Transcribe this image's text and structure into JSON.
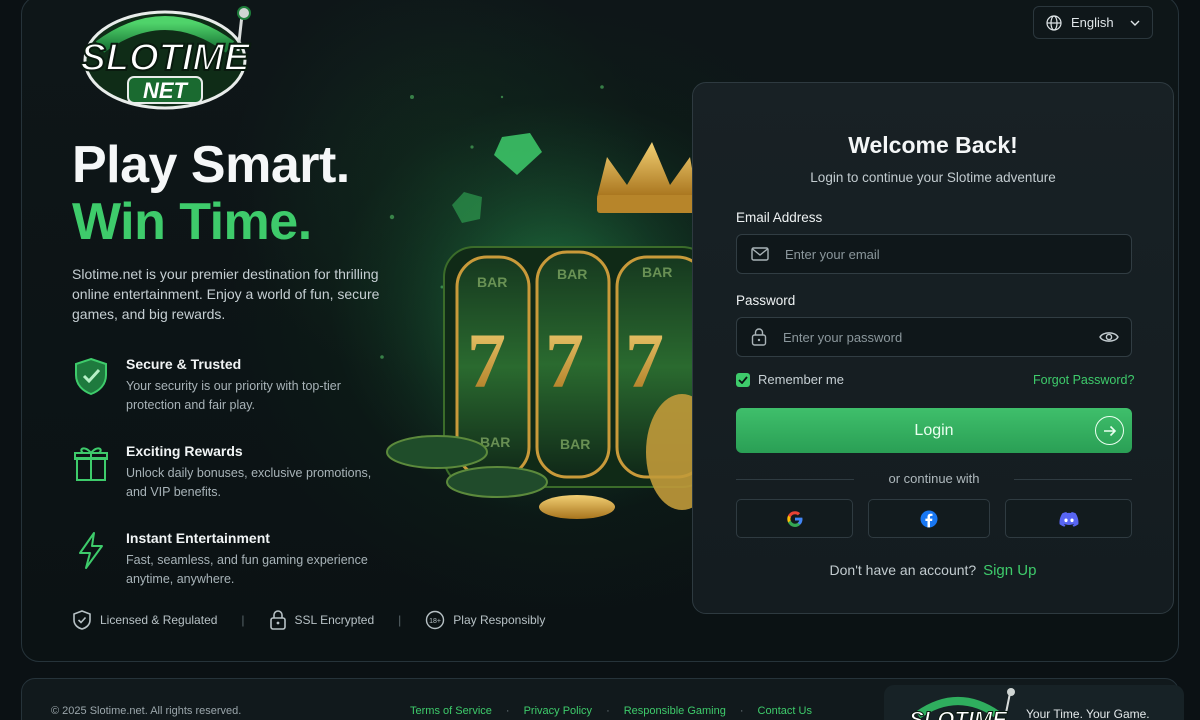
{
  "brand": {
    "logo_line1": "SLOTIME",
    "logo_line2": "NET"
  },
  "language": {
    "selected": "English",
    "icon": "globe-icon"
  },
  "hero": {
    "headline_line1": "Play Smart.",
    "headline_line2": "Win Time.",
    "intro": "Slotime.net is your premier destination for thrilling online entertainment. Enjoy a world of fun, secure games, and big rewards.",
    "features": [
      {
        "title": "Secure & Trusted",
        "desc": "Your security is our priority with top-tier protection and fair play.",
        "icon": "shield-check-icon"
      },
      {
        "title": "Exciting Rewards",
        "desc": "Unlock daily bonuses, exclusive promotions, and VIP benefits.",
        "icon": "gift-icon"
      },
      {
        "title": "Instant Entertainment",
        "desc": "Fast, seamless, and fun gaming experience anytime, anywhere.",
        "icon": "lightning-icon"
      }
    ],
    "badges": [
      {
        "label": "Licensed & Regulated",
        "icon": "shield-icon"
      },
      {
        "label": "SSL Encrypted",
        "icon": "lock-icon"
      },
      {
        "label": "Play Responsibly",
        "icon": "age-18-icon",
        "icon_text": "18+"
      }
    ]
  },
  "login": {
    "title": "Welcome Back!",
    "subtitle": "Login to continue your Slotime adventure",
    "email_label": "Email Address",
    "email_placeholder": "Enter your email",
    "password_label": "Password",
    "password_placeholder": "Enter your password",
    "remember_label": "Remember me",
    "remember_checked": true,
    "forgot_label": "Forgot Password?",
    "submit_label": "Login",
    "divider_text": "or continue with",
    "social": [
      "google-icon",
      "facebook-icon",
      "discord-icon"
    ],
    "no_account_text": "Don't have an account?",
    "signup_label": "Sign Up"
  },
  "footer": {
    "copyright": "© 2025 Slotime.net. All rights reserved.",
    "links": [
      "Terms of Service",
      "Privacy Policy",
      "Responsible Gaming",
      "Contact Us"
    ],
    "tagline": "Your Time. Your Game.",
    "logo_text": "SLOTIME"
  },
  "colors": {
    "accent": "#3ecb6b",
    "background": "#0b1114",
    "card": "#182125",
    "button": "#2fae5e"
  }
}
